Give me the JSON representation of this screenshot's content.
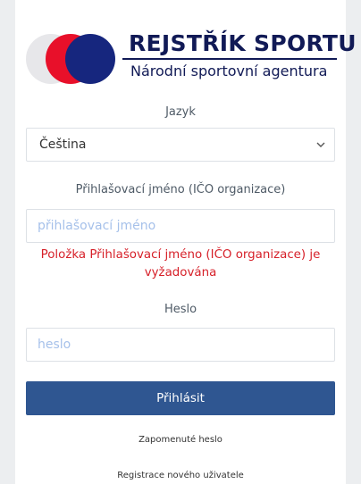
{
  "logo": {
    "title": "REJSTŘÍK SPORTU",
    "subtitle": "Národní sportovní agentura",
    "colors": {
      "navy": "#16267e",
      "red": "#e8102a",
      "grey": "#e7e7ea"
    }
  },
  "language": {
    "label": "Jazyk",
    "selected": "Čeština",
    "icon": "chevron-down-icon"
  },
  "username": {
    "label": "Přihlašovací jméno (IČO organizace)",
    "placeholder": "přihlašovací jméno",
    "value": "",
    "error": "Položka Přihlašovací jméno (IČO organizace) je vyžadována"
  },
  "password": {
    "label": "Heslo",
    "placeholder": "heslo",
    "value": ""
  },
  "actions": {
    "login_label": "Přihlásit",
    "forgot_label": "Zapomenuté heslo",
    "register_label": "Registrace nového uživatele"
  },
  "colors": {
    "button": "#2f5691",
    "error": "#d61f28",
    "placeholder": "#a6c1ea",
    "background": "#eceef0"
  }
}
